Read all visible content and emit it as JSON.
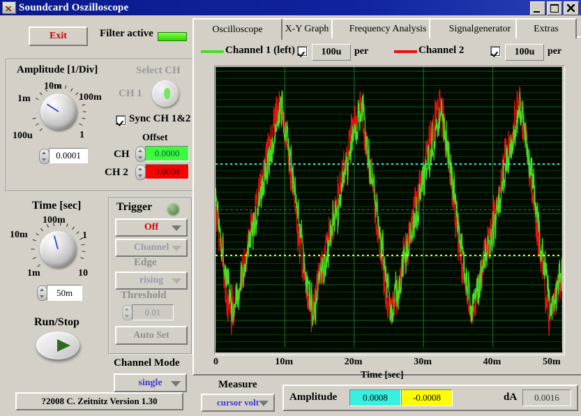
{
  "window": {
    "title": "Soundcard Oszilloscope",
    "icon": "oscilloscope-icon",
    "minimize": "minimize-icon",
    "maximize": "maximize-icon",
    "close": "close-icon"
  },
  "toolbar": {
    "exit_label": "Exit",
    "filter_label": "Filter active",
    "filter_led_color": "#4fe000"
  },
  "amplitude": {
    "title": "Amplitude [1/Div]",
    "knob_labels": [
      "1m",
      "10m",
      "100m",
      "1",
      "100u"
    ],
    "value": "0.0001",
    "select_ch_label": "Select CH",
    "ch_label": "CH 1",
    "sync_label": "Sync CH 1&2",
    "sync_checked": true,
    "offset_title": "Offset",
    "offset_ch1_label": "CH",
    "offset_ch1_value": "0.0000",
    "offset_ch1_color": "#3cfa3c",
    "offset_ch2_label": "CH 2",
    "offset_ch2_value": "0.0000",
    "offset_ch2_color": "#fb0000"
  },
  "time": {
    "title": "Time [sec]",
    "knob_labels": [
      "10m",
      "100m",
      "1",
      "10",
      "1m"
    ],
    "value": "50m",
    "runstop_label": "Run/Stop"
  },
  "trigger": {
    "title": "Trigger",
    "led_color": "#6d9b5c",
    "mode": "Off",
    "channel": "Channel",
    "edge_label": "Edge",
    "edge": "rising",
    "threshold_label": "Threshold",
    "threshold": "0.01",
    "autoset_label": "Auto Set"
  },
  "channel_mode": {
    "label": "Channel Mode",
    "value": "single"
  },
  "footer": {
    "version": "?2008   C. Zeitnitz Version 1.30"
  },
  "tabs": [
    {
      "label": "Oscilloscope",
      "selected": true
    },
    {
      "label": "X-Y Graph",
      "selected": false
    },
    {
      "label": "Frequency Analysis",
      "selected": false
    },
    {
      "label": "Signalgenerator",
      "selected": false
    },
    {
      "label": "Extras",
      "selected": false
    }
  ],
  "channels": [
    {
      "name": "Channel 1 (left)",
      "color": "#44e020",
      "enabled": true,
      "scale": "100u",
      "per": "per"
    },
    {
      "name": "Channel 2",
      "color": "#e81010",
      "enabled": true,
      "scale": "100u",
      "per": "per"
    }
  ],
  "measure": {
    "title": "Measure",
    "mode": "cursor volt",
    "amplitude_label": "Amplitude",
    "cursor1_value": "0.0008",
    "cursor1_color": "#37f0e0",
    "cursor2_value": "-0.0008",
    "cursor2_color": "#ffff00",
    "da_label": "dA",
    "da_value": "0.0016"
  },
  "chart_data": {
    "type": "line",
    "title": "",
    "xlabel": "Time [sec]",
    "ylabel": "",
    "xlim": [
      0,
      0.05
    ],
    "ylim": [
      -0.0025,
      0.0025
    ],
    "xticks": [
      0,
      0.01,
      0.02,
      0.03,
      0.04,
      0.05
    ],
    "xtick_labels": [
      "0",
      "10m",
      "20m",
      "30m",
      "40m",
      "50m"
    ],
    "grid": true,
    "background": "#010a01",
    "grid_color": "#0f5a12",
    "cursors": [
      {
        "name": "cursor-1",
        "value": 0.0008,
        "color": "#37f0e0",
        "style": "dotted"
      },
      {
        "name": "cursor-2",
        "value": -0.0008,
        "color": "#ffff00",
        "style": "dotted"
      },
      {
        "name": "center-line",
        "value": 0.0,
        "color": "#2f8f3a",
        "style": "dashed"
      }
    ],
    "series": [
      {
        "name": "Channel 1 (left)",
        "color": "#44e020",
        "waveform": "noisy-sawtooth",
        "period_ms": 11.5,
        "amplitude": 0.0018,
        "noise": 0.00035,
        "phase_ms": 2.5
      },
      {
        "name": "Channel 2",
        "color": "#e81010",
        "waveform": "noisy-sawtooth",
        "period_ms": 11.5,
        "amplitude": 0.0019,
        "noise": 0.00038,
        "phase_ms": 2.2
      }
    ]
  }
}
